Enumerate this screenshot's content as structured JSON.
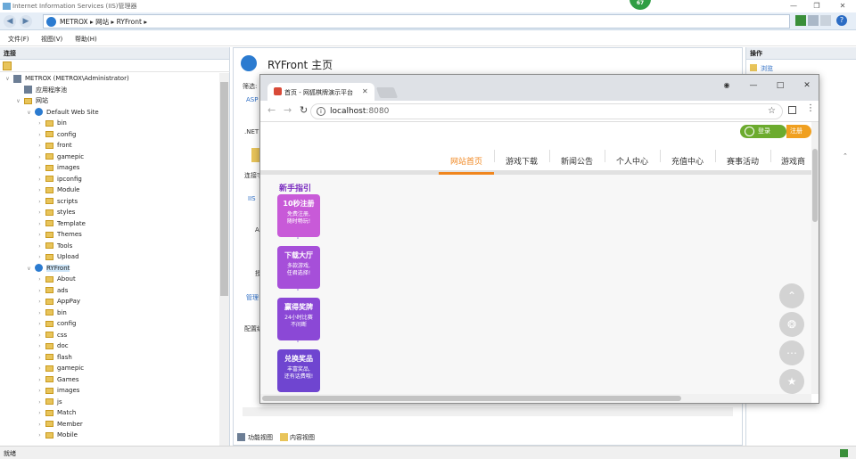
{
  "window": {
    "title": "Internet Information Services (IIS)管理器",
    "badge": "67"
  },
  "address": {
    "crumbs": [
      "METROX",
      "网站",
      "RYFront"
    ]
  },
  "menu": [
    "文件(F)",
    "视图(V)",
    "帮助(H)"
  ],
  "connections": {
    "title": "连接",
    "tree": [
      {
        "label": "METROX (METROX\\Administrator)",
        "indent": 0,
        "type": "server",
        "chev": "v"
      },
      {
        "label": "应用程序池",
        "indent": 1,
        "type": "pool",
        "chev": ""
      },
      {
        "label": "网站",
        "indent": 1,
        "type": "folder",
        "chev": "v"
      },
      {
        "label": "Default Web Site",
        "indent": 2,
        "type": "globe",
        "chev": "v"
      },
      {
        "label": "bin",
        "indent": 3,
        "type": "folder",
        "chev": ">"
      },
      {
        "label": "config",
        "indent": 3,
        "type": "folder",
        "chev": ">"
      },
      {
        "label": "front",
        "indent": 3,
        "type": "folder",
        "chev": ">"
      },
      {
        "label": "gamepic",
        "indent": 3,
        "type": "folder",
        "chev": ">"
      },
      {
        "label": "images",
        "indent": 3,
        "type": "folder",
        "chev": ">"
      },
      {
        "label": "ipconfig",
        "indent": 3,
        "type": "folder",
        "chev": ">"
      },
      {
        "label": "Module",
        "indent": 3,
        "type": "folder",
        "chev": ">"
      },
      {
        "label": "scripts",
        "indent": 3,
        "type": "folder",
        "chev": ">"
      },
      {
        "label": "styles",
        "indent": 3,
        "type": "folder",
        "chev": ">"
      },
      {
        "label": "Template",
        "indent": 3,
        "type": "folder",
        "chev": ">"
      },
      {
        "label": "Themes",
        "indent": 3,
        "type": "folder",
        "chev": ">"
      },
      {
        "label": "Tools",
        "indent": 3,
        "type": "folder",
        "chev": ">"
      },
      {
        "label": "Upload",
        "indent": 3,
        "type": "folder",
        "chev": ">"
      },
      {
        "label": "RYFront",
        "indent": 2,
        "type": "globe",
        "chev": "v",
        "selected": true
      },
      {
        "label": "About",
        "indent": 3,
        "type": "folder",
        "chev": ">"
      },
      {
        "label": "ads",
        "indent": 3,
        "type": "folder",
        "chev": ">"
      },
      {
        "label": "AppPay",
        "indent": 3,
        "type": "folder",
        "chev": ">"
      },
      {
        "label": "bin",
        "indent": 3,
        "type": "folder",
        "chev": ">"
      },
      {
        "label": "config",
        "indent": 3,
        "type": "folder",
        "chev": ">"
      },
      {
        "label": "css",
        "indent": 3,
        "type": "folder",
        "chev": ">"
      },
      {
        "label": "doc",
        "indent": 3,
        "type": "folder",
        "chev": ">"
      },
      {
        "label": "flash",
        "indent": 3,
        "type": "folder",
        "chev": ">"
      },
      {
        "label": "gamepic",
        "indent": 3,
        "type": "folder",
        "chev": ">"
      },
      {
        "label": "Games",
        "indent": 3,
        "type": "folder",
        "chev": ">"
      },
      {
        "label": "images",
        "indent": 3,
        "type": "folder",
        "chev": ">"
      },
      {
        "label": "js",
        "indent": 3,
        "type": "folder",
        "chev": ">"
      },
      {
        "label": "Match",
        "indent": 3,
        "type": "folder",
        "chev": ">"
      },
      {
        "label": "Member",
        "indent": 3,
        "type": "folder",
        "chev": ">"
      },
      {
        "label": "Mobile",
        "indent": 3,
        "type": "folder",
        "chev": ">"
      }
    ]
  },
  "center": {
    "title": "RYFront 主页",
    "side_labels": [
      "筛选:",
      "ASP",
      ".NET",
      "连接字",
      "IIS",
      "A",
      "授",
      "管理",
      "配置编"
    ],
    "view_tabs": [
      "功能视图",
      "内容视图"
    ]
  },
  "actions": {
    "title": "操作",
    "browse": "浏览"
  },
  "status": "就绪",
  "browser": {
    "tab_title": "首页 - 网狐棋牌演示平台",
    "url_host": "localhost",
    "url_port": ":8080",
    "site": {
      "login": "登录",
      "register": "注册",
      "nav": [
        "网站首页",
        "游戏下载",
        "新闻公告",
        "个人中心",
        "充值中心",
        "赛事活动",
        "游戏商"
      ],
      "guide_title": "新手指引",
      "guide": [
        {
          "title": "10秒注册",
          "line1": "免费注册,",
          "line2": "随时畅玩!",
          "color": "#c85ad8"
        },
        {
          "title": "下载大厅",
          "line1": "多款游戏,",
          "line2": "任君选择!",
          "color": "#a64fd9"
        },
        {
          "title": "赢得奖牌",
          "line1": "24小时比赛",
          "line2": "不间断",
          "color": "#8b48d6"
        },
        {
          "title": "兑换奖品",
          "line1": "丰富奖品,",
          "line2": "还有话费哦!",
          "color": "#6f45d0"
        }
      ]
    }
  }
}
